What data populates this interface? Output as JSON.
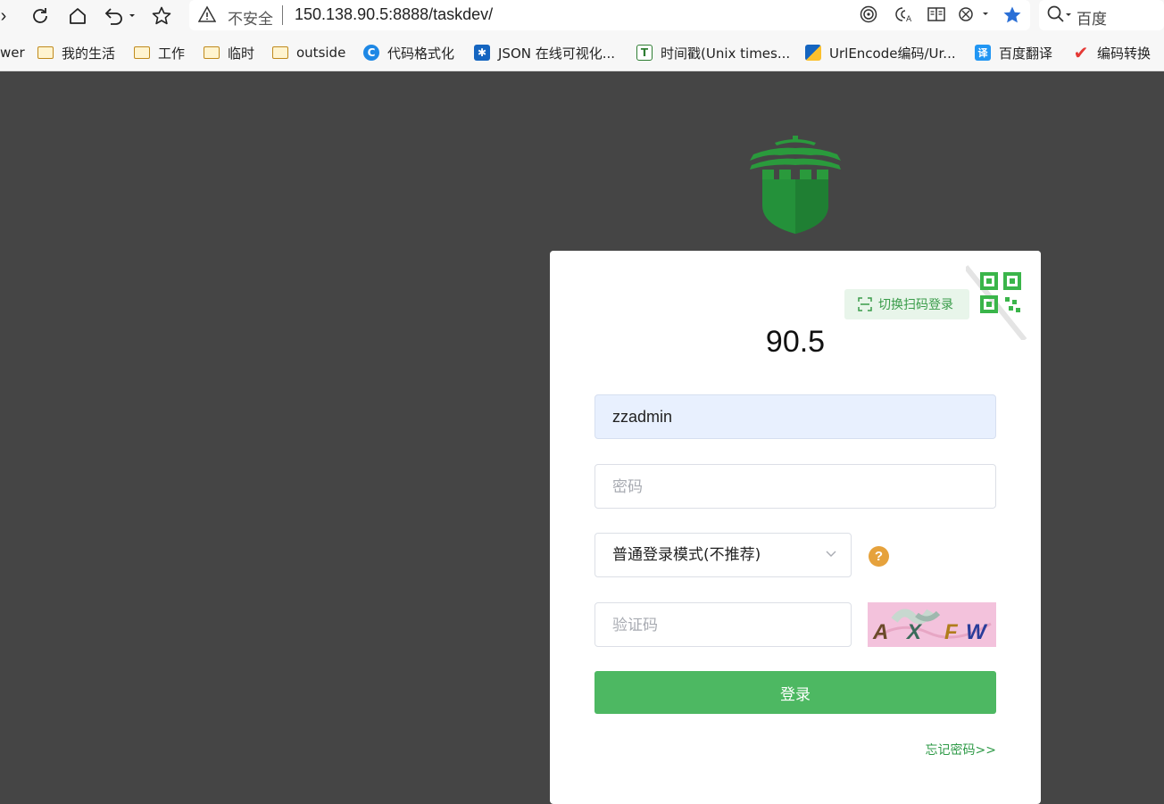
{
  "browser": {
    "url_security_label": "不安全",
    "url": "150.138.90.5:8888/taskdev/",
    "search_engine_label": "百度",
    "bookmarks": [
      {
        "label": "wer",
        "icon": "none"
      },
      {
        "label": "我的生活",
        "icon": "folder-icon"
      },
      {
        "label": "工作",
        "icon": "folder-icon"
      },
      {
        "label": "临时",
        "icon": "folder-icon"
      },
      {
        "label": "outside",
        "icon": "folder-icon"
      },
      {
        "label": "代码格式化",
        "icon": "code-format-icon"
      },
      {
        "label": "JSON 在线可视化...",
        "icon": "json-icon"
      },
      {
        "label": "时间戳(Unix times...",
        "icon": "timestamp-icon"
      },
      {
        "label": "UrlEncode编码/Ur...",
        "icon": "urlencode-icon"
      },
      {
        "label": "百度翻译",
        "icon": "translate-icon"
      },
      {
        "label": "编码转换",
        "icon": "checkmark-icon"
      }
    ]
  },
  "login": {
    "qr_toggle_label": "切换扫码登录",
    "title": "90.5",
    "username_value": "zzadmin",
    "password_placeholder": "密码",
    "mode_value": "普通登录模式(不推荐)",
    "help_symbol": "?",
    "captcha_placeholder": "验证码",
    "captcha_text": [
      "A",
      "X",
      "F",
      "W"
    ],
    "submit_label": "登录",
    "forgot_label": "忘记密码>>"
  },
  "colors": {
    "page_bg": "#454545",
    "primary": "#4db862",
    "link": "#2e9a47",
    "help": "#e6a23c"
  }
}
